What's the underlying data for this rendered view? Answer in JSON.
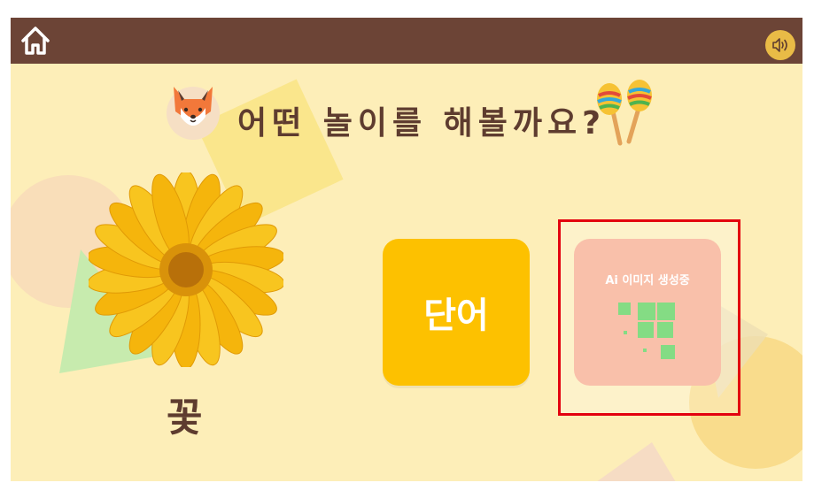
{
  "header": {
    "home_icon": "home-icon",
    "sound_icon": "speaker-icon"
  },
  "title": "어떤 놀이를 해볼까요?",
  "word": "꽃",
  "cards": {
    "word_label": "단어",
    "ai_label": "Ai 이미지 생성중"
  },
  "colors": {
    "topbar": "#6c4436",
    "background": "#fdeeb8",
    "word_card": "#fdc100",
    "ai_card": "#f7ab8e",
    "title_text": "#5e3c2f",
    "highlight": "#e3000f"
  }
}
